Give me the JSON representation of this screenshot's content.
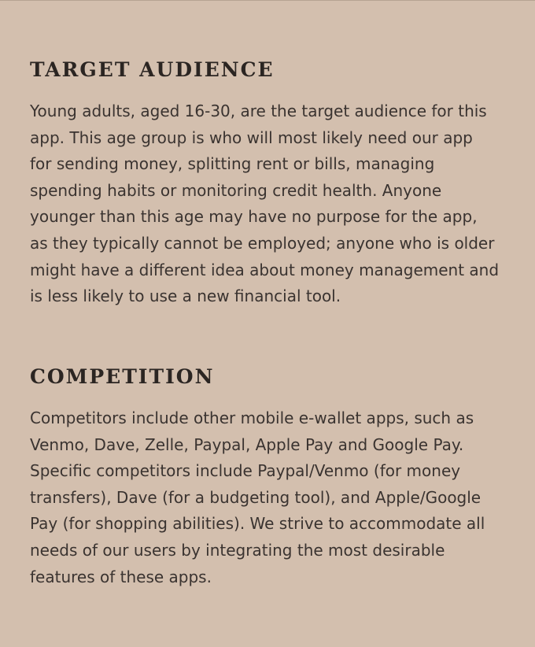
{
  "sections": [
    {
      "heading": "TARGET AUDIENCE",
      "lines": [
        "Young adults, aged 16-30, are the target audience for this",
        "app. This age group is who will most likely need our app",
        "for sending money, splitting rent or bills, managing",
        "spending habits or monitoring credit health. Anyone",
        "younger than this age may have no purpose for the app,",
        "as they typically cannot be employed; anyone who is older",
        "might have a different idea about money management and",
        "is less likely to use a new financial tool."
      ]
    },
    {
      "heading": "COMPETITION",
      "lines": [
        "Competitors include other mobile e-wallet apps, such as",
        "Venmo, Dave, Zelle, Paypal, Apple Pay and Google Pay.",
        "Specific competitors include Paypal/Venmo (for money",
        "transfers), Dave (for a budgeting tool), and Apple/Google",
        "Pay (for shopping abilities). We strive to accommodate all",
        "needs of our users by integrating the most desirable",
        "features of these apps."
      ]
    }
  ]
}
